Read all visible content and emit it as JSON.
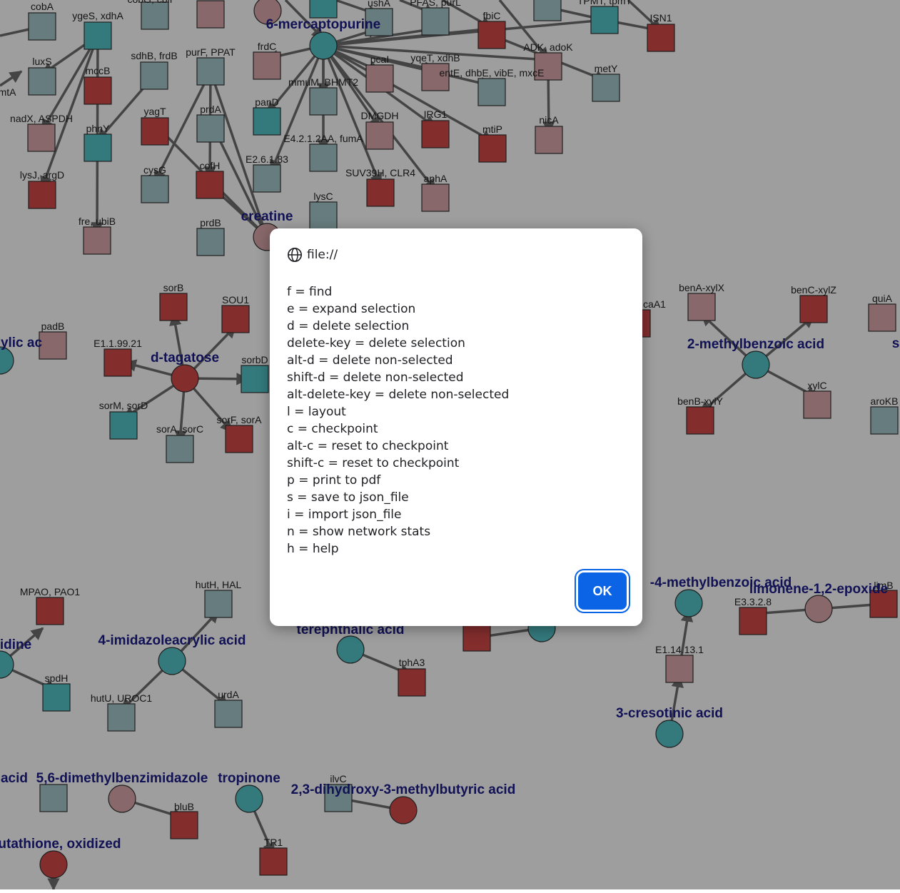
{
  "graph": {
    "colors": {
      "teal": "#55c5ca",
      "red": "#d34a4a",
      "pink": "#dba9ab",
      "gray_teal": "#a7c8cc",
      "edge": "#6e6e6e"
    },
    "compound_labels": [
      "6-mercaptopurine",
      "creatine",
      "d-tagatose",
      "2-methylbenzoic acid",
      "4-imidazoleacrylic acid",
      "terephthalic acid",
      "3-cresotinic acid",
      "limonene-1,2-epoxide",
      "5,6-dimethylbenzimidazole",
      "tropinone",
      "2,3-dihydroxy-3-methylbutyric acid",
      "glutathione, oxidized"
    ],
    "gene_labels": [
      "cobA",
      "ygeS, xdhA",
      "luxS",
      "mccB",
      "nadX, ASPDH",
      "phnY",
      "lysJ, argD",
      "fre, ubiB",
      "sdhB, frdB",
      "purF, PPAT",
      "yagT",
      "prdA",
      "cysG",
      "cofH",
      "prdB",
      "frdC",
      "panD",
      "E2.6.1.83",
      "mmuM, BHMT2",
      "E4.2.1.2AA, fumA",
      "lysC",
      "ushA",
      "pcaI",
      "DMGDH",
      "SUV39H, CLR4",
      "PFAS, purL",
      "yqeT, xdhB",
      "IRG1",
      "aphA",
      "fbiC",
      "entE, dhbE, vibE, mxcE",
      "mtiP",
      "ADK, adoK",
      "nicA",
      "TPMT, tpmT",
      "ISN1",
      "metY",
      "sorB",
      "SOU1",
      "padB",
      "E1.1.99.21",
      "sorbD",
      "sorM, sorD",
      "sorA, sorC",
      "sorF, sorA",
      "benA-xylX",
      "benC-xylZ",
      "quiA",
      "benB-xylY",
      "xylC",
      "aroKB",
      "caA1",
      "MPAO, PAO1",
      "hutH, HAL",
      "spdH",
      "hutU, UROC1",
      "urdA",
      "tphA3",
      "E3.3.2.8",
      "limB",
      "E1.14.13.1",
      "bluB",
      "TR1",
      "ilvC"
    ],
    "partial_labels": [
      "mtA",
      "ylic ac",
      "idine",
      "acid",
      "-4-methylbenzoic acid",
      "s",
      "cobG, cbiI"
    ]
  },
  "dialog": {
    "origin": "file://",
    "lines": [
      "f = find",
      "e = expand selection",
      "d = delete selection",
      "delete-key = delete selection",
      "alt-d = delete non-selected",
      "shift-d = delete non-selected",
      "alt-delete-key = delete non-selected",
      "l = layout",
      "c = checkpoint",
      "alt-c = reset to checkpoint",
      "shift-c = reset to checkpoint",
      "p = print to pdf",
      "s = save to json_file",
      "i = import json_file",
      "n = show network stats",
      "h = help"
    ],
    "ok_label": "OK"
  }
}
